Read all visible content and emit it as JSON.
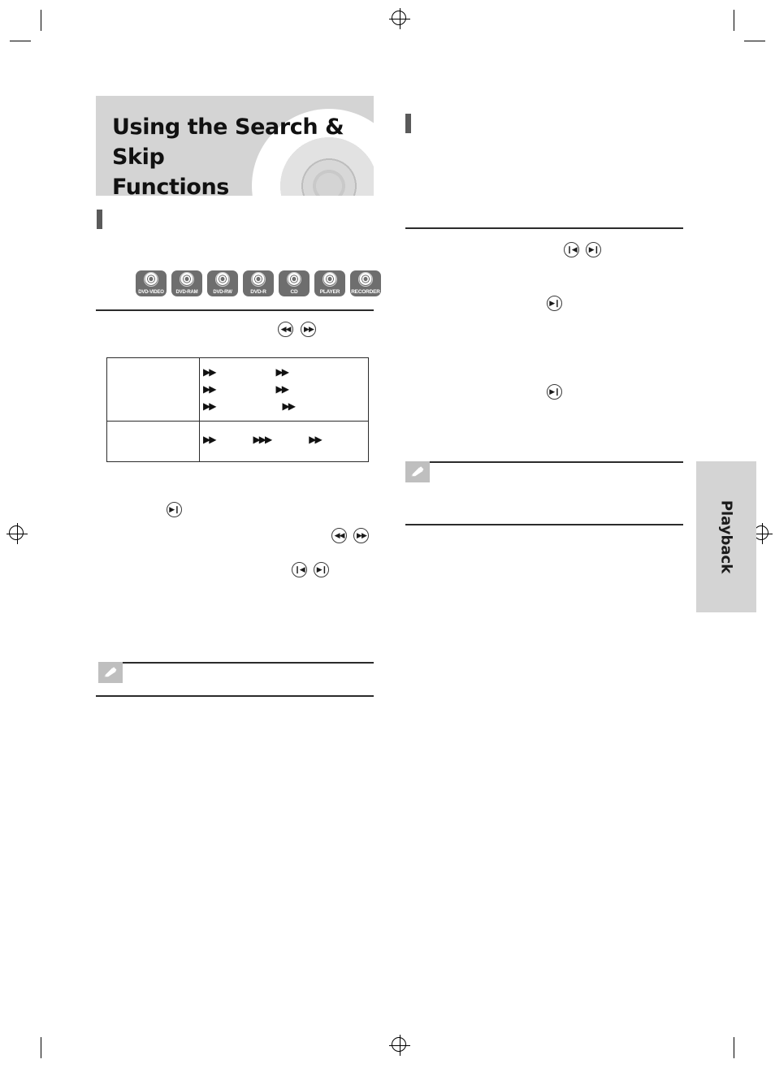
{
  "page": {
    "title_line1": "Using the Search & Skip",
    "title_line2": "Functions",
    "side_tab_label": "Playback"
  },
  "disc_badges": [
    {
      "name": "dvd-video-badge",
      "label": "DVD-VIDEO"
    },
    {
      "name": "dvd-ram-badge",
      "label": "DVD-RAM"
    },
    {
      "name": "dvd-rw-badge",
      "label": "DVD-RW"
    },
    {
      "name": "dvd-r-badge",
      "label": "DVD-R"
    },
    {
      "name": "cd-badge",
      "label": "CD"
    },
    {
      "name": "player-badge",
      "label": "PLAYER"
    },
    {
      "name": "recorder-badge",
      "label": "RECORDER"
    }
  ],
  "left_column": {
    "section_heading": "",
    "search_keys": [
      {
        "name": "search-back-key",
        "glyph": "◀◀"
      },
      {
        "name": "search-forward-key",
        "glyph": "▶▶"
      }
    ],
    "table": {
      "row_labels": [
        "",
        ""
      ],
      "row1_speeds": [
        "▶▶",
        "▶▶"
      ],
      "row2_speeds": [
        "▶▶",
        "▶▶"
      ],
      "row3_speeds": [
        "▶▶",
        "▶▶"
      ],
      "row4_speeds": [
        "▶▶",
        "▶▶▶",
        "▶▶"
      ]
    },
    "play_key": {
      "name": "play-pause-key",
      "glyph": "▶❙"
    },
    "skip_keys_1": [
      {
        "name": "skip-back-key",
        "glyph": "◀◀"
      },
      {
        "name": "skip-forward-key",
        "glyph": "▶▶"
      }
    ],
    "skip_keys_2": [
      {
        "name": "skip-prev-key",
        "glyph": "❙◀"
      },
      {
        "name": "skip-next-key",
        "glyph": "▶❙"
      }
    ],
    "note_icon": "pencil-note-icon"
  },
  "right_column": {
    "section_heading": "",
    "skip_keys_top": [
      {
        "name": "skip-prev-key-right",
        "glyph": "❙◀"
      },
      {
        "name": "skip-next-key-right",
        "glyph": "▶❙"
      }
    ],
    "skip_key_mid": {
      "name": "skip-next-key-mid",
      "glyph": "▶❙"
    },
    "skip_key_low": {
      "name": "skip-next-key-low",
      "glyph": "▶❙"
    },
    "note_icon": "pencil-note-icon"
  }
}
